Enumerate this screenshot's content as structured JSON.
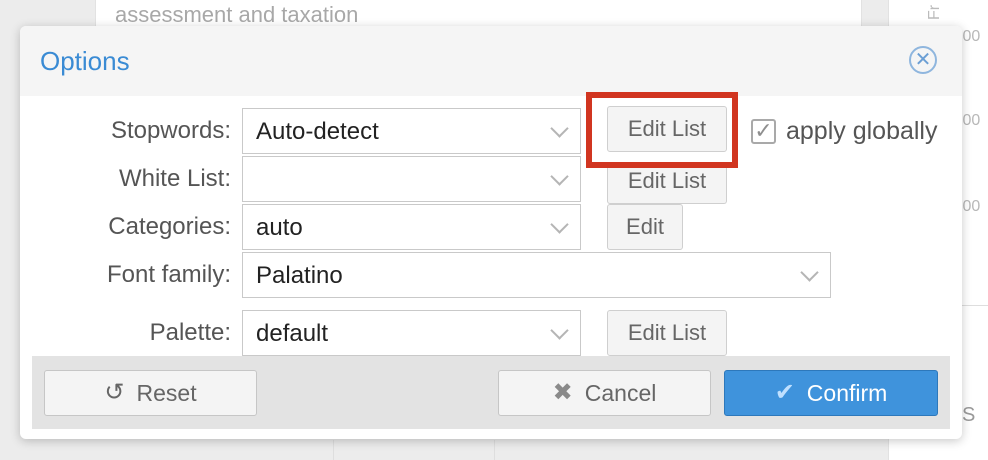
{
  "background": {
    "top_text": "assessment and taxation",
    "right_values": [
      ".00",
      ".00",
      ".00"
    ],
    "right_vertical_text": "Fr",
    "right_bottom_text": "S"
  },
  "dialog": {
    "title": "Options",
    "close_icon": "close-circle-icon",
    "rows": {
      "stopwords": {
        "label": "Stopwords:",
        "value": "Auto-detect",
        "button": "Edit List"
      },
      "whitelist": {
        "label": "White List:",
        "value": "",
        "button": "Edit List"
      },
      "categories": {
        "label": "Categories:",
        "value": "auto",
        "button": "Edit"
      },
      "font_family": {
        "label": "Font family:",
        "value": "Palatino"
      },
      "palette": {
        "label": "Palette:",
        "value": "default",
        "button": "Edit List"
      }
    },
    "apply_globally": {
      "label": "apply globally",
      "checked": true
    },
    "highlight_color": "#d13520"
  },
  "footer": {
    "reset": "Reset",
    "cancel": "Cancel",
    "confirm": "Confirm",
    "confirm_color": "#3f93dc"
  }
}
